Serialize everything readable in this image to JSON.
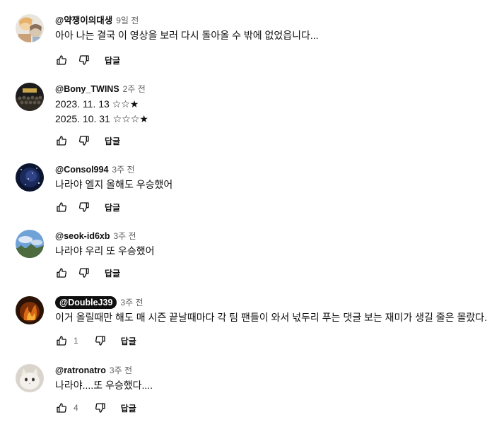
{
  "comments": [
    {
      "author": "@약쟁이의대생",
      "time": "9일 전",
      "lines": [
        "아아 나는 결국 이 영상을 보러 다시 돌아올 수 밖에 없었읍니다..."
      ],
      "likes": "",
      "reply_label": "답글",
      "avatar_icon": "anime-avatar-icon"
    },
    {
      "author": "@Bony_TWINS",
      "time": "2주 전",
      "lines": [
        "2023. 11. 13 ☆☆★",
        "2025. 10. 31 ☆☆☆★"
      ],
      "likes": "",
      "reply_label": "답글",
      "avatar_icon": "team-photo-avatar-icon"
    },
    {
      "author": "@Consol994",
      "time": "3주 전",
      "lines": [
        "나라야 엘지 올해도 우승했어"
      ],
      "likes": "",
      "reply_label": "답글",
      "avatar_icon": "night-sky-avatar-icon"
    },
    {
      "author": "@seok-id6xb",
      "time": "3주 전",
      "lines": [
        "나라야 우리 또 우승했어"
      ],
      "likes": "",
      "reply_label": "답글",
      "avatar_icon": "landscape-avatar-icon"
    },
    {
      "author": "@DoubleJ39",
      "time": "3주 전",
      "lines": [
        "이거 올릴때만 해도 매 시즌 끝날때마다 각 팀 팬들이 와서 넋두리 푸는 댓글 보는 재미가 생길 줄은 몰랐다."
      ],
      "likes": "1",
      "reply_label": "답글",
      "avatar_icon": "fire-avatar-icon",
      "author_highlighted": true
    },
    {
      "author": "@ratronatro",
      "time": "3주 전",
      "lines": [
        "나라야....또 우승했다...."
      ],
      "likes": "4",
      "reply_label": "답글",
      "avatar_icon": "cat-avatar-icon"
    }
  ],
  "colors": {
    "text": "#0f0f0f",
    "secondary": "#606060",
    "badge_bg": "#0f0f0f",
    "badge_text": "#ffffff"
  }
}
